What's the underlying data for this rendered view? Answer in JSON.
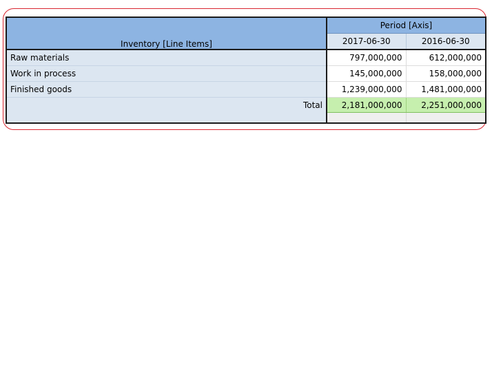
{
  "table": {
    "header": {
      "line_items": "Inventory [Line Items]",
      "axis": "Period [Axis]",
      "periods": [
        "2017-06-30",
        "2016-06-30"
      ]
    },
    "rows": [
      {
        "label": "Raw materials",
        "values": [
          "797,000,000",
          "612,000,000"
        ]
      },
      {
        "label": "Work in process",
        "values": [
          "145,000,000",
          "158,000,000"
        ]
      },
      {
        "label": "Finished goods",
        "values": [
          "1,239,000,000",
          "1,481,000,000"
        ]
      }
    ],
    "total": {
      "label": "Total",
      "values": [
        "2,181,000,000",
        "2,251,000,000"
      ]
    }
  },
  "colors": {
    "header_blue": "#8db4e2",
    "label_cell": "#dce6f1",
    "total_highlight": "#c6efae",
    "frame_outline": "#d9252f"
  }
}
